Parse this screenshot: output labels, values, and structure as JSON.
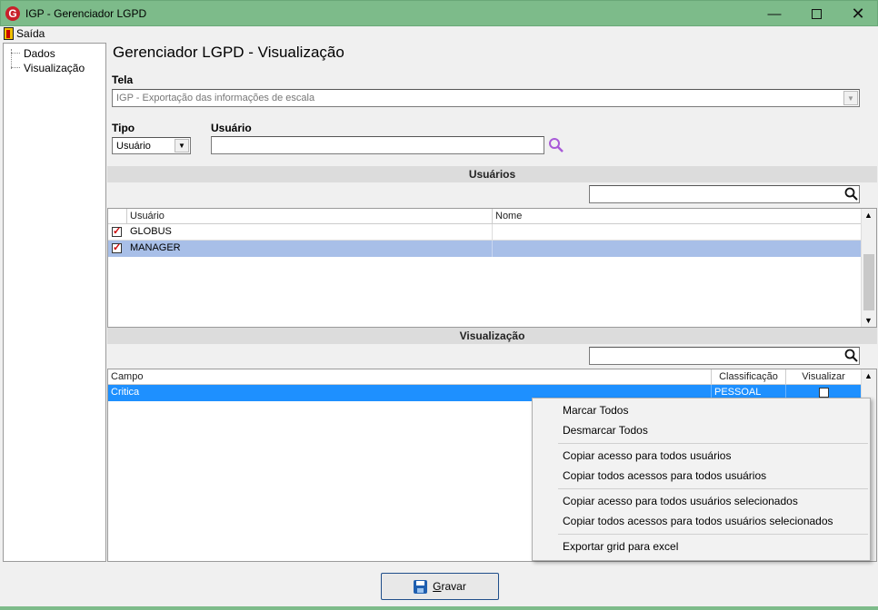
{
  "window": {
    "title": "IGP - Gerenciador LGPD"
  },
  "menu": {
    "exit_label": "Saída"
  },
  "tree": {
    "items": [
      {
        "label": "Dados"
      },
      {
        "label": "Visualização"
      }
    ]
  },
  "page": {
    "heading": "Gerenciador LGPD - Visualização"
  },
  "tela": {
    "label": "Tela",
    "value": "IGP - Exportação das informações de escala"
  },
  "tipo": {
    "label": "Tipo",
    "value": "Usuário"
  },
  "usuario": {
    "label": "Usuário",
    "value": ""
  },
  "users_section": {
    "title": "Usuários",
    "search_value": "",
    "columns": [
      "Usuário",
      "Nome"
    ],
    "rows": [
      {
        "checked": true,
        "usuario": "GLOBUS",
        "nome": ""
      },
      {
        "checked": true,
        "usuario": "MANAGER",
        "nome": ""
      }
    ]
  },
  "view_section": {
    "title": "Visualização",
    "search_value": "",
    "columns": [
      "Campo",
      "Classificação",
      "Visualizar"
    ],
    "rows": [
      {
        "campo": "Critica",
        "classificacao": "PESSOAL",
        "visualizar": false
      }
    ]
  },
  "context_menu": {
    "items": [
      "Marcar Todos",
      "Desmarcar Todos",
      "Copiar acesso para todos usuários",
      "Copiar todos acessos para todos usuários",
      "Copiar acesso para todos usuários selecionados",
      "Copiar todos acessos para todos usuários selecionados",
      "Exportar grid para excel"
    ]
  },
  "footer": {
    "save_label_underlined": "G",
    "save_label_rest": "ravar"
  },
  "colors": {
    "titlebar": "#7dbb8a",
    "selection": "#1e90ff",
    "row_highlight": "#a8bfe8",
    "check_mark": "#cc0000"
  }
}
